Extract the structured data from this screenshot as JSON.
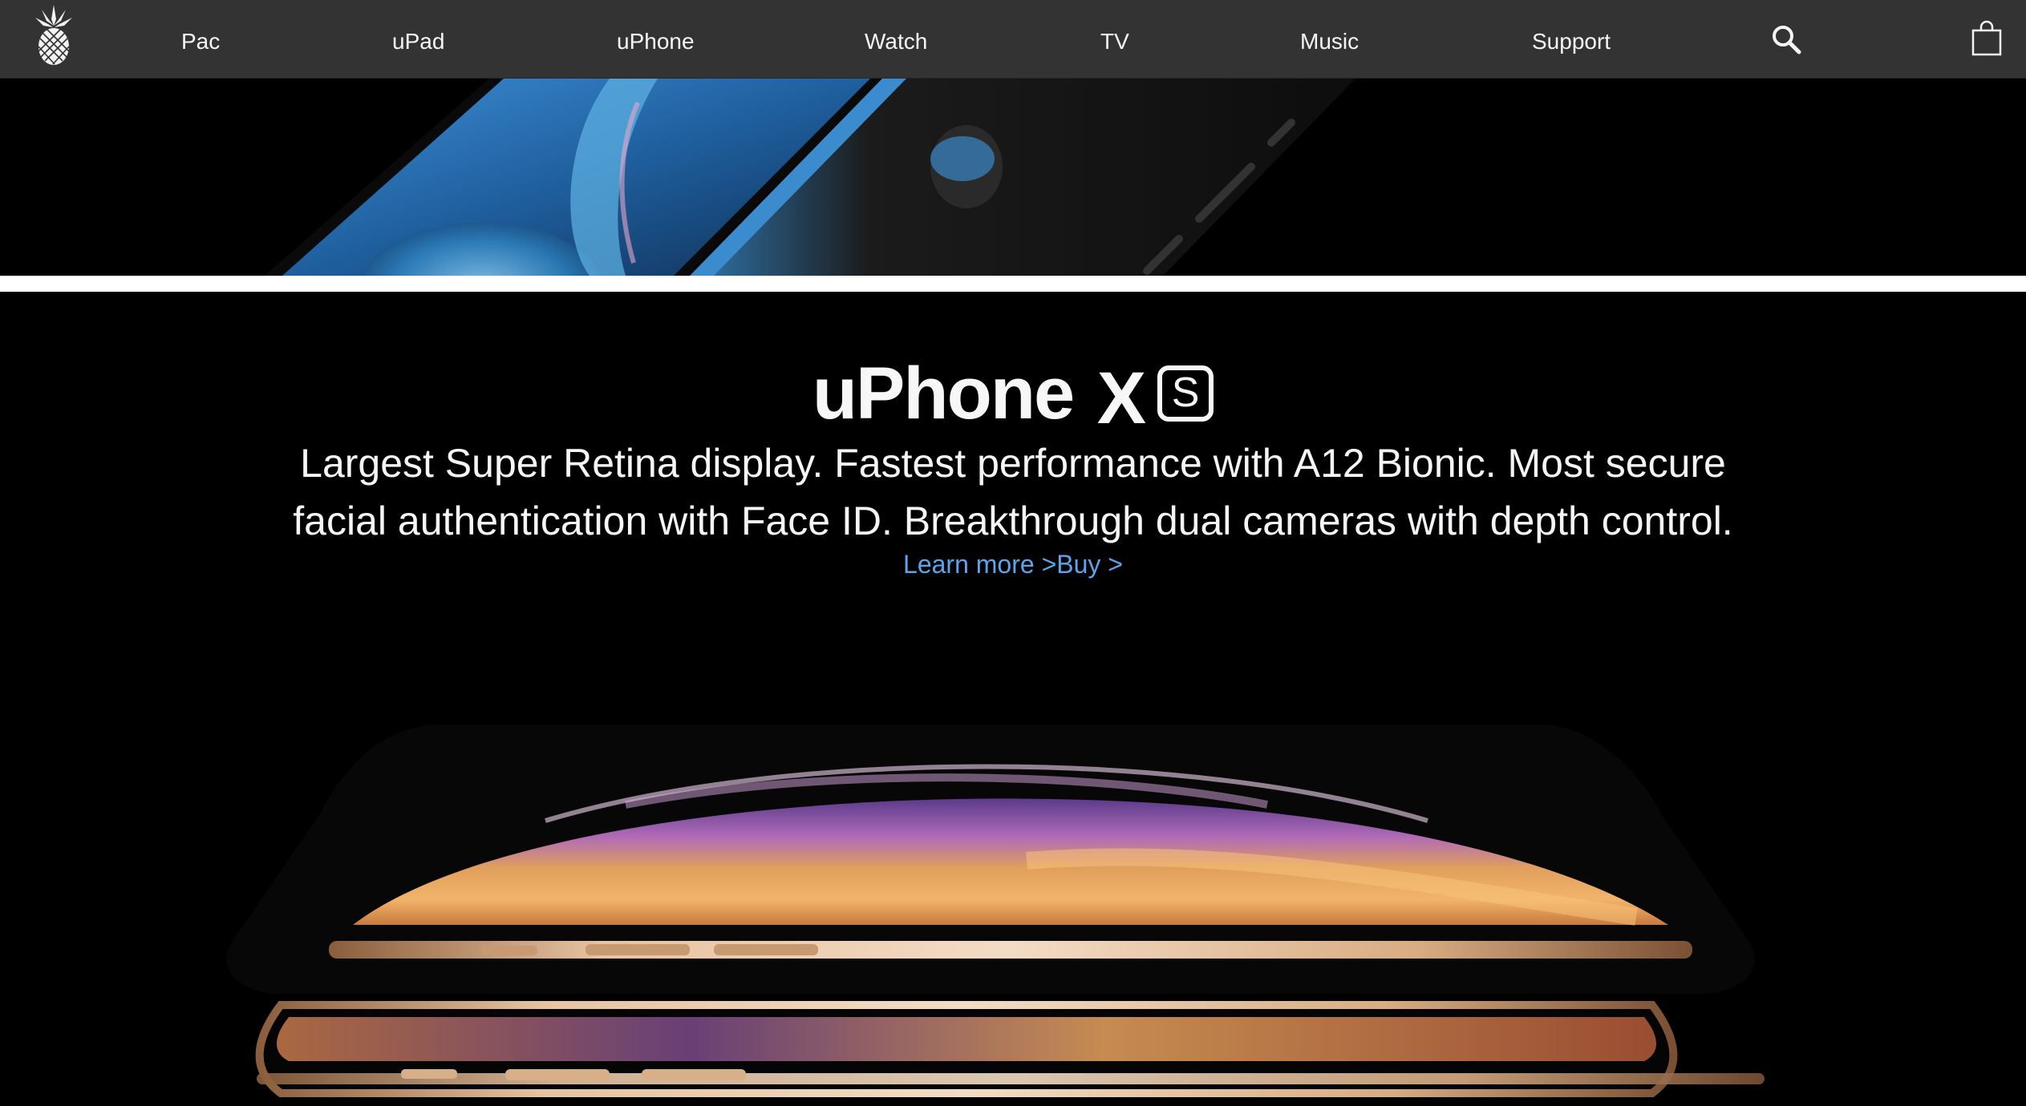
{
  "nav": {
    "logo_icon": "pineapple-logo-icon",
    "items": [
      {
        "label": "Pac"
      },
      {
        "label": "uPad"
      },
      {
        "label": "uPhone"
      },
      {
        "label": "Watch"
      },
      {
        "label": "TV"
      },
      {
        "label": "Music"
      },
      {
        "label": "Support"
      }
    ],
    "search_icon": "search-icon",
    "bag_icon": "shopping-bag-icon"
  },
  "hero": {
    "title_main": "uPhone",
    "title_suffix": "X",
    "title_badge": "S",
    "description": "Largest Super Retina display. Fastest performance with A12 Bionic. Most secure facial authentication with Face ID. Breakthrough dual cameras with depth control.",
    "learn_more": "Learn more >",
    "buy": "Buy >"
  },
  "colors": {
    "nav_bg": "#333333",
    "page_bg": "#000000",
    "link": "#5aa5ee",
    "divider": "#ffffff"
  }
}
